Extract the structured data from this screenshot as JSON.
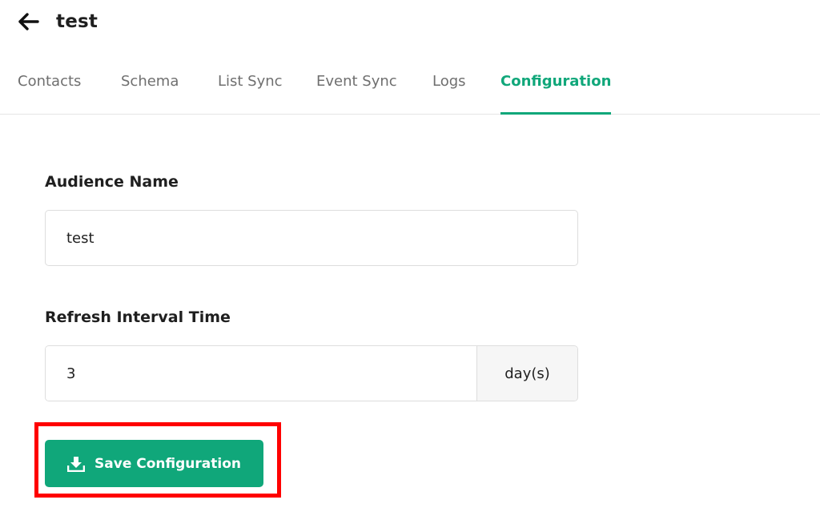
{
  "header": {
    "title": "test",
    "back_icon": "arrow-left-icon"
  },
  "tabs": [
    {
      "label": "Contacts",
      "active": false
    },
    {
      "label": "Schema",
      "active": false
    },
    {
      "label": "List Sync",
      "active": false
    },
    {
      "label": "Event Sync",
      "active": false
    },
    {
      "label": "Logs",
      "active": false
    },
    {
      "label": "Configuration",
      "active": true
    }
  ],
  "form": {
    "audience_name": {
      "label": "Audience Name",
      "value": "test"
    },
    "refresh_interval": {
      "label": "Refresh Interval Time",
      "value": "3",
      "unit": "day(s)"
    }
  },
  "actions": {
    "save_label": "Save Configuration",
    "save_icon": "download-icon"
  },
  "colors": {
    "accent": "#10a77a",
    "highlight": "#ff0000",
    "tab_inactive": "#6f6f6f"
  }
}
